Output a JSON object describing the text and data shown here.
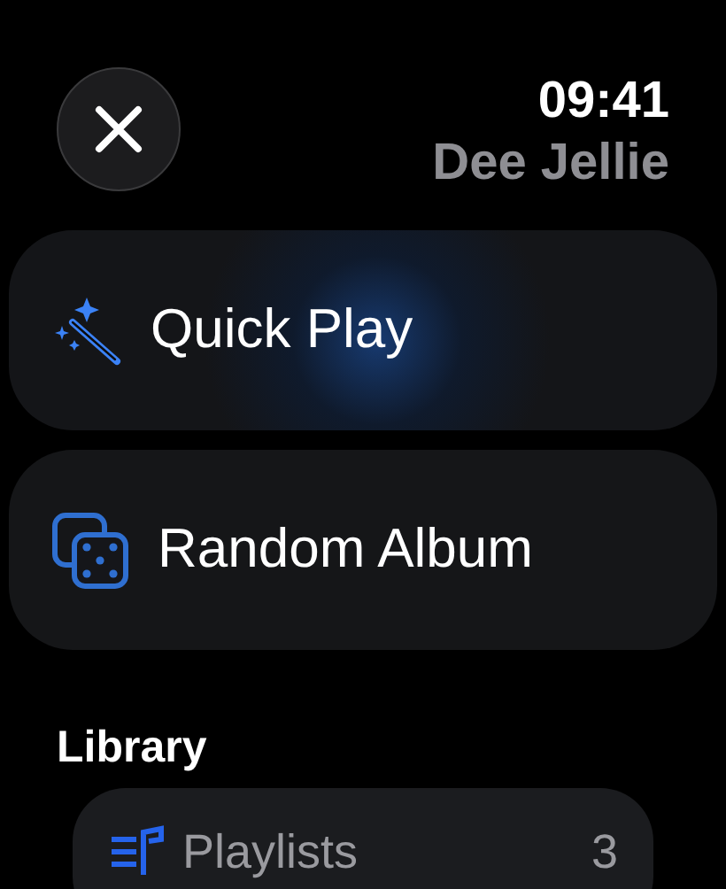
{
  "header": {
    "time": "09:41",
    "user_name": "Dee Jellie"
  },
  "actions": [
    {
      "kind": "quick_play",
      "label": "Quick Play",
      "highlighted": true
    },
    {
      "kind": "random_album",
      "label": "Random Album",
      "highlighted": false
    }
  ],
  "library": {
    "title": "Library",
    "items": [
      {
        "kind": "playlists",
        "label": "Playlists",
        "count": "3"
      }
    ]
  }
}
